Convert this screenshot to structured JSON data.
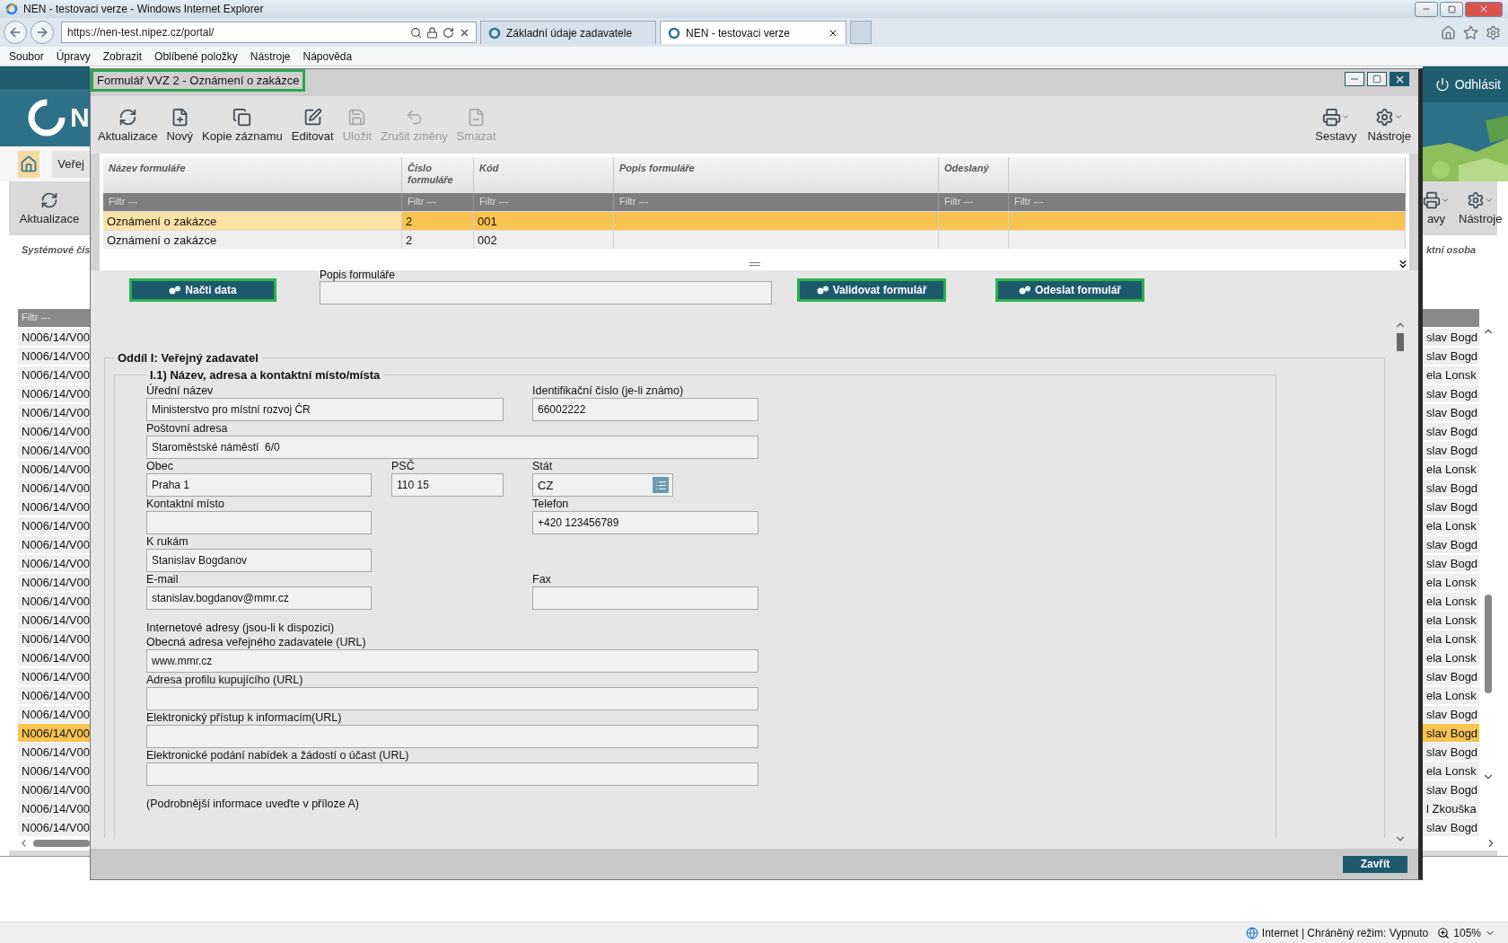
{
  "browser": {
    "title": "NEN - testovaci verze - Windows Internet Explorer",
    "address": "https://nen-test.nipez.cz/portal/",
    "tabs": [
      {
        "label": "Základní údaje zadavatele",
        "selected": false
      },
      {
        "label": "NEN - testovaci verze",
        "selected": true
      }
    ],
    "menu": [
      "Soubor",
      "Úpravy",
      "Zobrazit",
      "Oblíbené položky",
      "Nástroje",
      "Nápověda"
    ]
  },
  "background_page": {
    "logo_text": "N",
    "logout": "Odhlásit",
    "nav_tab": "Veřej",
    "left_toolbar": "Aktualizace",
    "right_toolbar": [
      "avy",
      "Nástroje"
    ],
    "left_column": {
      "header": "Systémové čís",
      "filter": "Filtr ---",
      "rows": [
        {
          "text": "N006/14/V00",
          "selected": false
        },
        {
          "text": "N006/14/V00",
          "selected": false
        },
        {
          "text": "N006/14/V00",
          "selected": false
        },
        {
          "text": "N006/14/V00",
          "selected": false
        },
        {
          "text": "N006/14/V00",
          "selected": false
        },
        {
          "text": "N006/14/V00",
          "selected": false
        },
        {
          "text": "N006/14/V00",
          "selected": false
        },
        {
          "text": "N006/14/V00",
          "selected": false
        },
        {
          "text": "N006/14/V00",
          "selected": false
        },
        {
          "text": "N006/14/V00",
          "selected": false
        },
        {
          "text": "N006/14/V00",
          "selected": false
        },
        {
          "text": "N006/14/V00",
          "selected": false
        },
        {
          "text": "N006/14/V00",
          "selected": false
        },
        {
          "text": "N006/14/V00",
          "selected": false
        },
        {
          "text": "N006/14/V00",
          "selected": false
        },
        {
          "text": "N006/14/V00",
          "selected": false
        },
        {
          "text": "N006/14/V00",
          "selected": false
        },
        {
          "text": "N006/14/V00",
          "selected": false
        },
        {
          "text": "N006/14/V00",
          "selected": false
        },
        {
          "text": "N006/14/V00",
          "selected": false
        },
        {
          "text": "N006/14/V00",
          "selected": false
        },
        {
          "text": "N006/14/V00",
          "selected": true
        },
        {
          "text": "N006/14/V00",
          "selected": false
        },
        {
          "text": "N006/14/V00",
          "selected": false
        },
        {
          "text": "N006/14/V00",
          "selected": false
        },
        {
          "text": "N006/14/V00",
          "selected": false
        },
        {
          "text": "N006/14/V00",
          "selected": false
        }
      ]
    },
    "right_column": {
      "header": "ktní osoba",
      "rows": [
        {
          "text": "slav Bogd",
          "selected": false
        },
        {
          "text": "slav Bogd",
          "selected": false
        },
        {
          "text": "ela Lonsk",
          "selected": false
        },
        {
          "text": "slav Bogd",
          "selected": false
        },
        {
          "text": "slav Bogd",
          "selected": false
        },
        {
          "text": "slav Bogd",
          "selected": false
        },
        {
          "text": "slav Bogd",
          "selected": false
        },
        {
          "text": "ela Lonsk",
          "selected": false
        },
        {
          "text": "slav Bogd",
          "selected": false
        },
        {
          "text": "slav Bogd",
          "selected": false
        },
        {
          "text": "ela Lonsk",
          "selected": false
        },
        {
          "text": "slav Bogd",
          "selected": false
        },
        {
          "text": "slav Bogd",
          "selected": false
        },
        {
          "text": "ela Lonsk",
          "selected": false
        },
        {
          "text": "ela Lonsk",
          "selected": false
        },
        {
          "text": "ela Lonsk",
          "selected": false
        },
        {
          "text": "ela Lonsk",
          "selected": false
        },
        {
          "text": "ela Lonsk",
          "selected": false
        },
        {
          "text": "slav Bogd",
          "selected": false
        },
        {
          "text": "ela Lonsk",
          "selected": false
        },
        {
          "text": "slav Bogd",
          "selected": false
        },
        {
          "text": "slav Bogd",
          "selected": true
        },
        {
          "text": "slav Bogd",
          "selected": false
        },
        {
          "text": "ela Lonsk",
          "selected": false
        },
        {
          "text": "slav Bogd",
          "selected": false
        },
        {
          "text": "l Zkouška",
          "selected": false
        },
        {
          "text": "slav Bogd",
          "selected": false
        }
      ]
    }
  },
  "dialog": {
    "title": {
      "text": "Formulář VVZ 2 - Oznámení o zakázce",
      "highlighted": true
    },
    "toolbar": [
      {
        "kind": "refresh",
        "label": "Aktualizace",
        "disabled": false
      },
      {
        "kind": "new",
        "label": "Nový",
        "disabled": false
      },
      {
        "kind": "copy",
        "label": "Kopie záznamu",
        "disabled": false
      },
      {
        "kind": "edit",
        "label": "Editovat",
        "disabled": false
      },
      {
        "kind": "save",
        "label": "Uložit",
        "disabled": true
      },
      {
        "kind": "undo",
        "label": "Zrušit změny",
        "disabled": true
      },
      {
        "kind": "delete",
        "label": "Smazat",
        "disabled": true
      }
    ],
    "tools": [
      {
        "kind": "print",
        "label": "Sestavy"
      },
      {
        "kind": "gear",
        "label": "Nástroje"
      }
    ],
    "table": {
      "columns": [
        "Název formuláře",
        "Číslo formuláře",
        "Kód",
        "Popis formuláře",
        "Odeslaný"
      ],
      "filters": [
        "Filtr ---",
        "Filtr ---",
        "Filtr ---",
        "Filtr ---",
        "Filtr ---",
        "Filtr ---"
      ],
      "rows": [
        {
          "cells": [
            "Oznámení o zakázce",
            "2",
            "001"
          ],
          "selected": true
        },
        {
          "cells": [
            "Oznámení o zakázce",
            "2",
            "002"
          ],
          "selected": false
        }
      ]
    },
    "action_bar": [
      {
        "kind": "button",
        "label": "Načti data",
        "highlighted": true
      },
      {
        "kind": "field",
        "label": "Popis formuláře"
      },
      {
        "kind": "button",
        "label": "Validovat formulář",
        "highlighted": true
      },
      {
        "kind": "button",
        "label": "Odeslat formulář",
        "highlighted": true
      }
    ],
    "form": {
      "section": "Oddíl I: Veřejný zadavatel",
      "subsection": "I.1) Název, adresa a kontaktní místo/místa",
      "fields": [
        {
          "kind": "name",
          "label": "Úřední název",
          "value": "Ministerstvo pro místní rozvoj ČR"
        },
        {
          "kind": "right",
          "label": "Identifikační číslo (je-li známo)",
          "value": "66002222"
        },
        {
          "kind": "wide",
          "label": "Poštovní adresa",
          "value": "Staroměstské náměstí  6/0"
        },
        {
          "kind": "half",
          "label": "Obec",
          "value": "Praha 1"
        },
        {
          "kind": "short",
          "label": "PSČ",
          "value": "110 15"
        },
        {
          "kind": "select",
          "label": "Stát",
          "value": "CZ"
        },
        {
          "kind": "half",
          "label": "Kontaktní místo"
        },
        {
          "kind": "right",
          "label": "Telefon",
          "value": "+420 123456789"
        },
        {
          "kind": "half",
          "label": "K rukám",
          "value": "Stanislav Bogdanov"
        },
        {
          "kind": "half",
          "label": "E-mail",
          "value": "stanislav.bogdanov@mmr.cz"
        },
        {
          "kind": "right",
          "label": "Fax"
        },
        {
          "kind": "note",
          "label": "Internetové adresy (jsou-li k dispozici)"
        },
        {
          "kind": "wide",
          "label": "Obecná adresa veřejného zadavatele (URL)",
          "value": "www.mmr.cz"
        },
        {
          "kind": "wide",
          "label": "Adresa profilu kupujícího (URL)"
        },
        {
          "kind": "wide",
          "label": "Elektronický přístup k informacím(URL)"
        },
        {
          "kind": "wide",
          "label": "Elektronické podání nabídek a žádostí o účast (URL)"
        },
        {
          "kind": "note",
          "label": "(Podrobnější informace uveďte v příloze A)"
        }
      ]
    },
    "close_button": "Zavřít"
  },
  "status_bar": {
    "zone": "Internet | Chráněný režim: Vypnuto",
    "zoom": "105%"
  }
}
